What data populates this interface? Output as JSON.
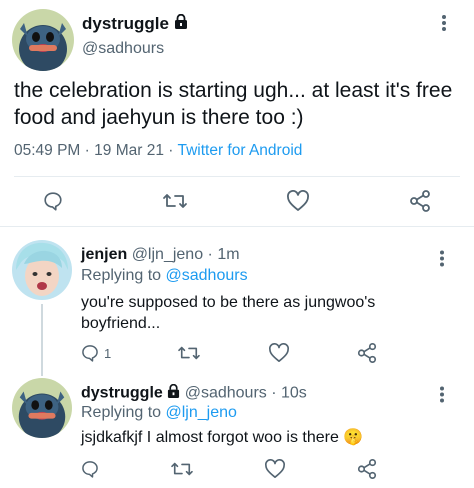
{
  "main_tweet": {
    "display_name": "dystruggle",
    "handle": "@sadhours",
    "text": "the celebration is starting ugh... at least it's free food and jaehyun is there too :)",
    "time": "05:49 PM",
    "dot1": "·",
    "date": "19 Mar 21",
    "dot2": "·",
    "source": "Twitter for Android",
    "more_label": "⋮"
  },
  "replies": [
    {
      "display_name": "jenjen",
      "handle": "@ljn_jeno",
      "sep": "·",
      "time": "1m",
      "replying_prefix": "Replying to",
      "replying_to": "@sadhours",
      "text": "you're supposed to be there as jungwoo's boyfriend...",
      "reply_count": "1",
      "more_label": "⋮"
    },
    {
      "display_name": "dystruggle",
      "handle": "@sadhours",
      "sep": "·",
      "time": "10s",
      "replying_prefix": "Replying to",
      "replying_to": "@ljn_jeno",
      "text": "jsjdkafkjf I almost forgot woo is there",
      "emoji": "🤫",
      "more_label": "⋮"
    }
  ],
  "icons": {
    "reply": "reply-icon",
    "retweet": "retweet-icon",
    "like": "heart-icon",
    "share": "share-icon",
    "lock": "lock-icon",
    "more": "more-vertical-icon"
  },
  "colors": {
    "link": "#1d9bf0",
    "secondary_text": "#536471",
    "primary_text": "#0f1419",
    "divider": "#e6ecf0"
  }
}
